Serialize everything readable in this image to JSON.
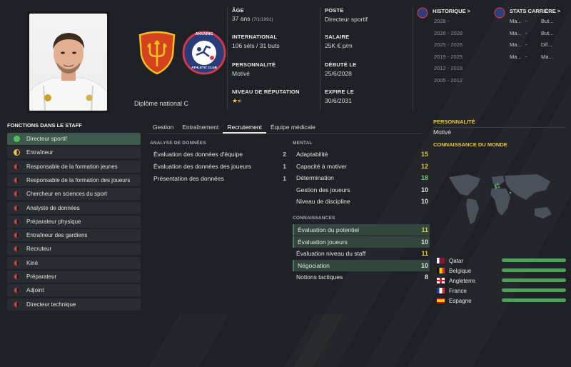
{
  "header": {
    "diploma": "Diplôme national C",
    "age_label": "ÂGE",
    "age_value": "37 ans",
    "age_dob": "(7/1/1991)",
    "international_label": "INTERNATIONAL",
    "international_value": "106 séls / 31 buts",
    "personality_label": "PERSONNALITÉ",
    "personality_value": "Motivé",
    "reputation_label": "NIVEAU DE RÉPUTATION",
    "reputation_stars": 1.5,
    "post_label": "POSTE",
    "post_value": "Directeur sportif",
    "salary_label": "SALAIRE",
    "salary_value": "25K € p/m",
    "debut_label": "DÉBUTÉ LE",
    "debut_value": "25/6/2028",
    "expire_label": "EXPIRE LE",
    "expire_value": "30/6/2031",
    "club_badge_text": "ANVAING",
    "club_badge_subtext": "ATHLETIC CLUB"
  },
  "history": {
    "title": "HISTORIQUE >",
    "years": [
      "2028 -",
      "2026 - 2028",
      "2025 - 2026",
      "2019 - 2025",
      "2012 - 2019",
      "2005 - 2012"
    ]
  },
  "career_stats": {
    "title": "STATS CARRIÈRE >",
    "rows": [
      {
        "a": "Ma...",
        "b": "-",
        "c": "But..."
      },
      {
        "a": "Ma...",
        "b": "-",
        "c": "But..."
      },
      {
        "a": "Ma...",
        "b": "-",
        "c": "Dif..."
      },
      {
        "a": "Ma...",
        "b": "-",
        "c": "Ma..."
      }
    ]
  },
  "staff_panel": {
    "title": "FONCTIONS DANS LE STAFF",
    "roles": [
      {
        "label": "Directeur sportif",
        "dot": "green",
        "active": true
      },
      {
        "label": "Entraîneur",
        "dot": "yellow-half",
        "active": false
      },
      {
        "label": "Responsable de la formation jeunes",
        "dot": "red-half",
        "active": false
      },
      {
        "label": "Responsable de la formation des joueurs",
        "dot": "red-half",
        "active": false
      },
      {
        "label": "Chercheur en sciences du sport",
        "dot": "red-half",
        "active": false
      },
      {
        "label": "Analyste de données",
        "dot": "red-half",
        "active": false
      },
      {
        "label": "Préparateur physique",
        "dot": "red-half",
        "active": false
      },
      {
        "label": "Entraîneur des gardiens",
        "dot": "red-half",
        "active": false
      },
      {
        "label": "Recruteur",
        "dot": "red-half",
        "active": false
      },
      {
        "label": "Kiné",
        "dot": "red-half",
        "active": false
      },
      {
        "label": "Préparateur",
        "dot": "red-half",
        "active": false
      },
      {
        "label": "Adjoint",
        "dot": "red-half",
        "active": false
      },
      {
        "label": "Directeur technique",
        "dot": "red-half",
        "active": false
      }
    ]
  },
  "tabs": [
    "Gestion",
    "Entraînement",
    "Recrutement",
    "Équipe médicale"
  ],
  "active_tab": "Recrutement",
  "data_analysis": {
    "title": "ANALYSE DE DONNÉES",
    "rows": [
      {
        "label": "Évaluation des données d'équipe",
        "value": "2"
      },
      {
        "label": "Évaluation des données des joueurs",
        "value": "1"
      },
      {
        "label": "Présentation des données",
        "value": "1"
      }
    ]
  },
  "mental": {
    "title": "MENTAL",
    "rows": [
      {
        "label": "Adaptabilité",
        "value": "15",
        "color": "#e2c93a"
      },
      {
        "label": "Capacité à motiver",
        "value": "12",
        "color": "#e2c93a"
      },
      {
        "label": "Détermination",
        "value": "18",
        "color": "#6fd36a"
      },
      {
        "label": "Gestion des joueurs",
        "value": "10",
        "color": "#e2e4e6"
      },
      {
        "label": "Niveau de discipline",
        "value": "10",
        "color": "#e2e4e6"
      }
    ]
  },
  "knowledge": {
    "title": "CONNAISSANCES",
    "rows": [
      {
        "label": "Évaluation du potentiel",
        "value": "11",
        "color": "#e2c93a",
        "highlight": true
      },
      {
        "label": "Évaluation joueurs",
        "value": "10",
        "color": "#e2e4e6",
        "highlight": true
      },
      {
        "label": "Évaluation niveau du staff",
        "value": "11",
        "color": "#e2c93a",
        "highlight": false
      },
      {
        "label": "Négociation",
        "value": "10",
        "color": "#e2e4e6",
        "highlight": true
      },
      {
        "label": "Notions tactiques",
        "value": "8",
        "color": "#e2e4e6",
        "highlight": false
      }
    ]
  },
  "right_col": {
    "personality_title": "PERSONNALITÉ",
    "personality_value": "Motivé",
    "world_title": "CONNAISSANCE DU MONDE",
    "countries": [
      "Qatar",
      "Belgique",
      "Angleterre",
      "France",
      "Espagne"
    ]
  },
  "colors": {
    "accent_green": "#4fa15a",
    "active_row": "#3d5a4d",
    "section_yellow": "#e7c44a"
  }
}
